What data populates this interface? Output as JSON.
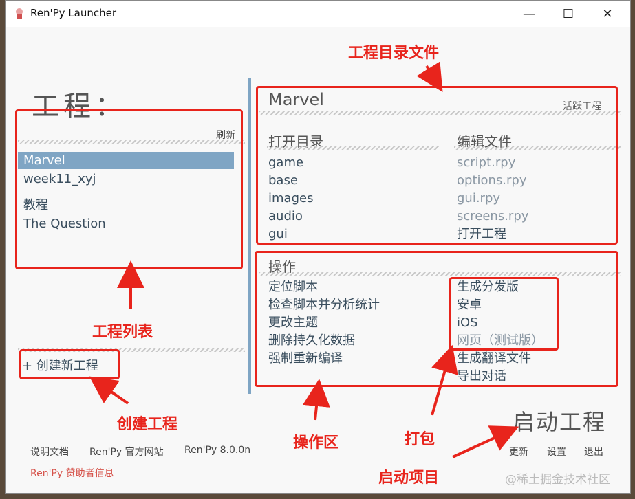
{
  "window": {
    "title": "Ren'Py Launcher",
    "min": "—",
    "max": "☐",
    "close": "✕"
  },
  "left": {
    "title": "工程：",
    "refresh": "刷新",
    "projects": [
      "Marvel",
      "week11_xyj"
    ],
    "tutorials": [
      "教程",
      "The Question"
    ],
    "create": "+ 创建新工程",
    "footer": {
      "docs": "说明文档",
      "website": "Ren'Py 官方网站",
      "version": "Ren'Py 8.0.0n",
      "sponsor": "Ren'Py 赞助者信息"
    }
  },
  "right": {
    "project_name": "Marvel",
    "active_label": "活跃工程",
    "open_dir_head": "打开目录",
    "open_dirs": [
      "game",
      "base",
      "images",
      "audio",
      "gui"
    ],
    "edit_head": "编辑文件",
    "edit_files": [
      "script.rpy",
      "options.rpy",
      "gui.rpy",
      "screens.rpy"
    ],
    "edit_all": "打开工程",
    "actions_head": "操作",
    "actions_left": [
      "定位脚本",
      "检查脚本并分析统计",
      "更改主题",
      "删除持久化数据",
      "强制重新编译"
    ],
    "actions_right": [
      "生成分发版",
      "安卓",
      "iOS",
      "网页（测试版）",
      "生成翻译文件",
      "导出对话"
    ],
    "launch": "启动工程",
    "bottom": {
      "update": "更新",
      "settings": "设置",
      "quit": "退出"
    }
  },
  "annotations": {
    "project_dir": "工程目录文件",
    "project_list": "工程列表",
    "create_project": "创建工程",
    "action_area": "操作区",
    "package": "打包",
    "launch_project": "启动项目"
  },
  "watermark": "@稀土掘金技术社区",
  "colors": {
    "accent": "#7fa5c4",
    "annotation": "#e8241c",
    "link": "#3a4e5e",
    "sponsor": "#d6524a"
  }
}
